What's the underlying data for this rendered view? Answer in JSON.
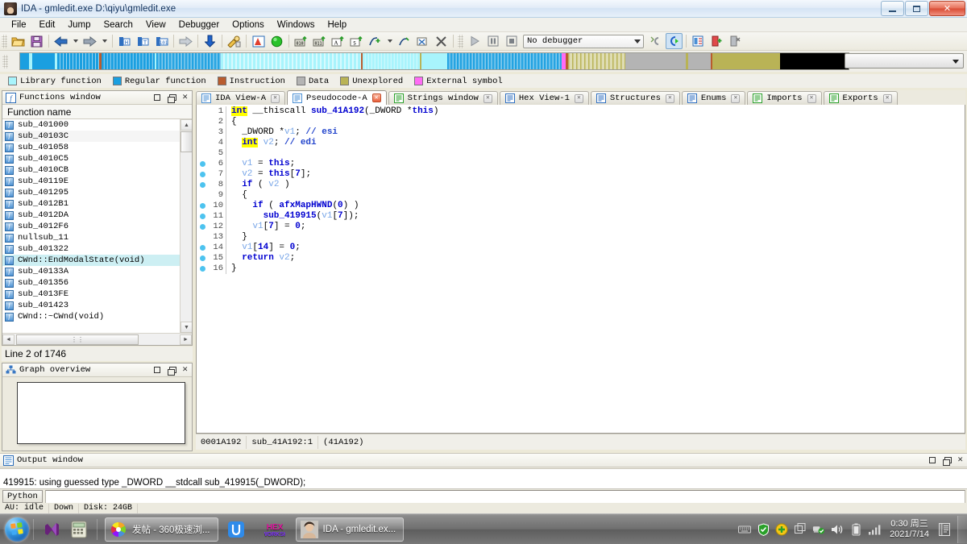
{
  "window": {
    "title": "IDA - gmledit.exe D:\\qiyu\\gmledit.exe",
    "icon": "ida-avatar-icon",
    "minimize": "–",
    "maximize": "□",
    "close": "✕"
  },
  "menu": {
    "items": [
      {
        "label": "File",
        "accel": "F"
      },
      {
        "label": "Edit",
        "accel": "E"
      },
      {
        "label": "Jump",
        "accel": "J"
      },
      {
        "label": "Search",
        "accel": "c"
      },
      {
        "label": "View",
        "accel": "V"
      },
      {
        "label": "Debugger",
        "accel": "u"
      },
      {
        "label": "Options",
        "accel": "O"
      },
      {
        "label": "Windows",
        "accel": "W"
      },
      {
        "label": "Help",
        "accel": "H"
      }
    ]
  },
  "toolbar": {
    "debugger_select": "No debugger",
    "buttons": [
      "open-file-icon",
      "save-icon",
      "navigate-back-icon",
      "navigate-forward-icon",
      "jump-to-address-icon",
      "jump-to-name-icon",
      "jump-by-number-icon",
      "jump-forward-icon",
      "jump-down-icon",
      "search-key-icon",
      "graph-view-icon",
      "run-to-icon",
      "make-data-icon",
      "make-data-array-icon",
      "make-ascii-icon",
      "make-struct-icon",
      "add-function-icon",
      "edit-function-icon",
      "delete-function-icon",
      "run-icon",
      "pause-icon",
      "stop-icon",
      "step-c-icon",
      "continue-c-icon",
      "breakpoint-list-icon",
      "add-breakpoint-icon",
      "delete-breakpoint-icon"
    ]
  },
  "navigator": {
    "legend": [
      {
        "label": "Library function",
        "color": "#a8f4fc"
      },
      {
        "label": "Regular function",
        "color": "#1a9fe0"
      },
      {
        "label": "Instruction",
        "color": "#b95c2e"
      },
      {
        "label": "Data",
        "color": "#b4b4b4"
      },
      {
        "label": "Unexplored",
        "color": "#bdb martin"
      },
      {
        "label": "External symbol",
        "color": "#ff6cf5"
      }
    ],
    "legend_colors": {
      "library": "#a8f4fc",
      "regular": "#1a9fe0",
      "instruction": "#b95c2e",
      "data": "#b4b4b4",
      "unexplored": "#b9b356",
      "external": "#ff6cf5"
    },
    "combo_value": ""
  },
  "functions_panel": {
    "title": "Functions window",
    "icon": "functions-window-icon",
    "column_header": "Function name",
    "status": "Line 2 of 1746",
    "rows": [
      {
        "name": "sub_401000",
        "selected": false
      },
      {
        "name": "sub_40103C",
        "selected": false
      },
      {
        "name": "sub_401058",
        "selected": false
      },
      {
        "name": "sub_4010C5",
        "selected": false
      },
      {
        "name": "sub_4010CB",
        "selected": false
      },
      {
        "name": "sub_40119E",
        "selected": false
      },
      {
        "name": "sub_401295",
        "selected": false
      },
      {
        "name": "sub_4012B1",
        "selected": false
      },
      {
        "name": "sub_4012DA",
        "selected": false
      },
      {
        "name": "sub_4012F6",
        "selected": false
      },
      {
        "name": "nullsub_11",
        "selected": false
      },
      {
        "name": "sub_401322",
        "selected": false
      },
      {
        "name": "CWnd::EndModalState(void)",
        "selected": true
      },
      {
        "name": "sub_40133A",
        "selected": false
      },
      {
        "name": "sub_401356",
        "selected": false
      },
      {
        "name": "sub_4013FE",
        "selected": false
      },
      {
        "name": "sub_401423",
        "selected": false
      },
      {
        "name": "CWnd::~CWnd(void)",
        "selected": false
      }
    ]
  },
  "graph_overview": {
    "title": "Graph overview",
    "icon": "graph-overview-icon"
  },
  "tabs": [
    {
      "label": "IDA View-A",
      "icon": "ida-view-icon",
      "active": false
    },
    {
      "label": "Pseudocode-A",
      "icon": "pseudocode-icon",
      "active": true
    },
    {
      "label": "Strings window",
      "icon": "strings-icon",
      "active": false
    },
    {
      "label": "Hex View-1",
      "icon": "hex-view-icon",
      "active": false
    },
    {
      "label": "Structures",
      "icon": "structures-icon",
      "active": false
    },
    {
      "label": "Enums",
      "icon": "enums-icon",
      "active": false
    },
    {
      "label": "Imports",
      "icon": "imports-icon",
      "active": false
    },
    {
      "label": "Exports",
      "icon": "exports-icon",
      "active": false
    }
  ],
  "pseudocode": {
    "lines": [
      {
        "n": 1,
        "bp": false,
        "tokens": [
          {
            "t": "int",
            "c": "hl"
          },
          {
            "t": " __thiscall ",
            "c": "pnc"
          },
          {
            "t": "sub_41A192",
            "c": "fnm"
          },
          {
            "t": "(_DWORD *",
            "c": "pnc"
          },
          {
            "t": "this",
            "c": "k"
          },
          {
            "t": ")",
            "c": "pnc"
          }
        ]
      },
      {
        "n": 2,
        "bp": false,
        "tokens": [
          {
            "t": "{",
            "c": "pnc"
          }
        ]
      },
      {
        "n": 3,
        "bp": false,
        "tokens": [
          {
            "t": "  _DWORD *",
            "c": "pnc"
          },
          {
            "t": "v1",
            "c": "var"
          },
          {
            "t": "; ",
            "c": "pnc"
          },
          {
            "t": "// esi",
            "c": "cmt"
          }
        ]
      },
      {
        "n": 4,
        "bp": false,
        "tokens": [
          {
            "t": "  ",
            "c": "pnc"
          },
          {
            "t": "int",
            "c": "hl"
          },
          {
            "t": " ",
            "c": "pnc"
          },
          {
            "t": "v2",
            "c": "var"
          },
          {
            "t": "; ",
            "c": "pnc"
          },
          {
            "t": "// edi",
            "c": "cmt"
          }
        ]
      },
      {
        "n": 5,
        "bp": false,
        "tokens": [
          {
            "t": "",
            "c": "pnc"
          }
        ]
      },
      {
        "n": 6,
        "bp": true,
        "tokens": [
          {
            "t": "  ",
            "c": "pnc"
          },
          {
            "t": "v1",
            "c": "var"
          },
          {
            "t": " = ",
            "c": "pnc"
          },
          {
            "t": "this",
            "c": "k"
          },
          {
            "t": ";",
            "c": "pnc"
          }
        ]
      },
      {
        "n": 7,
        "bp": true,
        "tokens": [
          {
            "t": "  ",
            "c": "pnc"
          },
          {
            "t": "v2",
            "c": "var"
          },
          {
            "t": " = ",
            "c": "pnc"
          },
          {
            "t": "this",
            "c": "k"
          },
          {
            "t": "[",
            "c": "pnc"
          },
          {
            "t": "7",
            "c": "num"
          },
          {
            "t": "];",
            "c": "pnc"
          }
        ]
      },
      {
        "n": 8,
        "bp": true,
        "tokens": [
          {
            "t": "  ",
            "c": "pnc"
          },
          {
            "t": "if",
            "c": "k"
          },
          {
            "t": " ( ",
            "c": "pnc"
          },
          {
            "t": "v2",
            "c": "var"
          },
          {
            "t": " )",
            "c": "pnc"
          }
        ]
      },
      {
        "n": 9,
        "bp": false,
        "tokens": [
          {
            "t": "  {",
            "c": "pnc"
          }
        ]
      },
      {
        "n": 10,
        "bp": true,
        "tokens": [
          {
            "t": "    ",
            "c": "pnc"
          },
          {
            "t": "if",
            "c": "k"
          },
          {
            "t": " ( ",
            "c": "pnc"
          },
          {
            "t": "afxMapHWND",
            "c": "fnm"
          },
          {
            "t": "(",
            "c": "pnc"
          },
          {
            "t": "0",
            "c": "num"
          },
          {
            "t": ") )",
            "c": "pnc"
          }
        ]
      },
      {
        "n": 11,
        "bp": true,
        "tokens": [
          {
            "t": "      ",
            "c": "pnc"
          },
          {
            "t": "sub_419915",
            "c": "fnm"
          },
          {
            "t": "(",
            "c": "pnc"
          },
          {
            "t": "v1",
            "c": "var"
          },
          {
            "t": "[",
            "c": "pnc"
          },
          {
            "t": "7",
            "c": "num"
          },
          {
            "t": "]);",
            "c": "pnc"
          }
        ]
      },
      {
        "n": 12,
        "bp": true,
        "tokens": [
          {
            "t": "    ",
            "c": "pnc"
          },
          {
            "t": "v1",
            "c": "var"
          },
          {
            "t": "[",
            "c": "pnc"
          },
          {
            "t": "7",
            "c": "num"
          },
          {
            "t": "] = ",
            "c": "pnc"
          },
          {
            "t": "0",
            "c": "num"
          },
          {
            "t": ";",
            "c": "pnc"
          }
        ]
      },
      {
        "n": 13,
        "bp": false,
        "tokens": [
          {
            "t": "  }",
            "c": "pnc"
          }
        ]
      },
      {
        "n": 14,
        "bp": true,
        "tokens": [
          {
            "t": "  ",
            "c": "pnc"
          },
          {
            "t": "v1",
            "c": "var"
          },
          {
            "t": "[",
            "c": "pnc"
          },
          {
            "t": "14",
            "c": "num"
          },
          {
            "t": "] = ",
            "c": "pnc"
          },
          {
            "t": "0",
            "c": "num"
          },
          {
            "t": ";",
            "c": "pnc"
          }
        ]
      },
      {
        "n": 15,
        "bp": true,
        "tokens": [
          {
            "t": "  ",
            "c": "pnc"
          },
          {
            "t": "return",
            "c": "k"
          },
          {
            "t": " ",
            "c": "pnc"
          },
          {
            "t": "v2",
            "c": "var"
          },
          {
            "t": ";",
            "c": "pnc"
          }
        ]
      },
      {
        "n": 16,
        "bp": true,
        "tokens": [
          {
            "t": "}",
            "c": "pnc"
          }
        ]
      }
    ],
    "status": {
      "address": "0001A192",
      "location": "sub_41A192:1",
      "offset": "(41A192)"
    }
  },
  "output_window": {
    "title": "Output window",
    "icon": "output-window-icon",
    "lines": [
      "419915: using guessed type _DWORD __stdcall sub_419915(_DWORD);"
    ],
    "cli_label": "Python",
    "cli_value": ""
  },
  "app_status": {
    "au": "AU: idle",
    "down": "Down",
    "disk": "Disk: 24GB"
  },
  "taskbar": {
    "start": "start-orb-icon",
    "quick_launch": [
      {
        "name": "visual-studio-icon"
      },
      {
        "name": "calculator-icon"
      }
    ],
    "items": [
      {
        "label": "发帖 - 360极速浏...",
        "icon": "360-browser-icon",
        "active": false
      },
      {
        "label": "",
        "icon": "u-app-icon",
        "active": false
      },
      {
        "label": "",
        "icon": "hex-workshop-icon",
        "active": false
      },
      {
        "label": "IDA - gmledit.ex...",
        "icon": "ida-avatar-icon",
        "active": true
      }
    ],
    "tray": [
      {
        "name": "keyboard-layout-icon"
      },
      {
        "name": "security-shield-icon"
      },
      {
        "name": "update-icon"
      },
      {
        "name": "windows-copy-icon"
      },
      {
        "name": "network-ok-icon"
      },
      {
        "name": "volume-icon"
      },
      {
        "name": "battery-icon"
      },
      {
        "name": "signal-bars-icon"
      }
    ],
    "clock_time": "0:30 周三",
    "clock_date": "2021/7/14",
    "action_center": "action-center-icon"
  }
}
